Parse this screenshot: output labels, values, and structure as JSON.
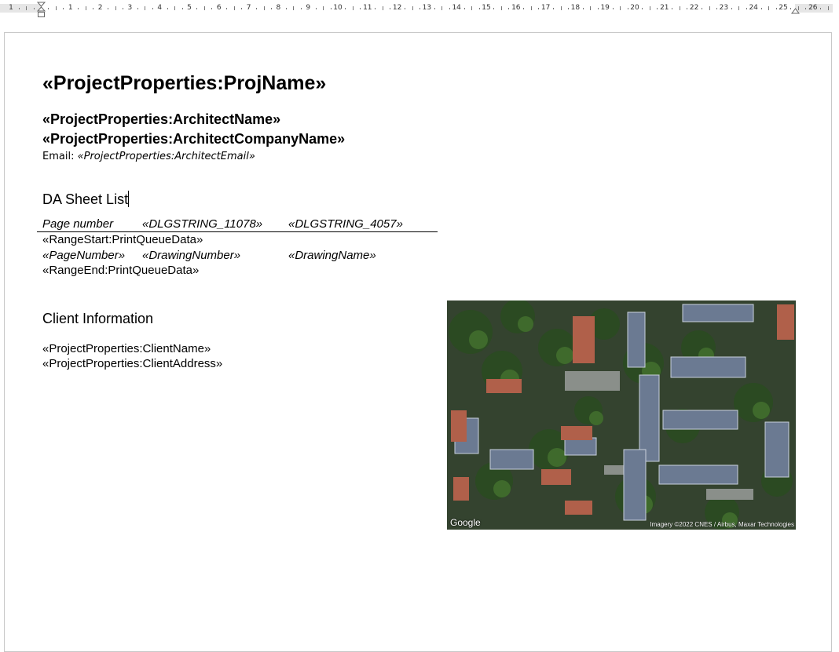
{
  "ruler": {
    "numbers": [
      "1",
      "1",
      "2",
      "3",
      "4",
      "5",
      "6",
      "7",
      "8",
      "9",
      "10",
      "11",
      "12",
      "13",
      "14",
      "15",
      "16",
      "17",
      "18",
      "19",
      "20",
      "21",
      "22",
      "23",
      "24",
      "25",
      "26"
    ]
  },
  "document": {
    "project_name_field": "«ProjectProperties:ProjName»",
    "architect_name_field": "«ProjectProperties:ArchitectName»",
    "architect_company_field": "«ProjectProperties:ArchitectCompanyName»",
    "email_label": "Email: ",
    "architect_email_field": "«ProjectProperties:ArchitectEmail»",
    "sheet_list_heading": "DA Sheet List",
    "table": {
      "headers": [
        "Page number",
        "«DLGSTRING_11078»",
        "«DLGSTRING_4057»"
      ],
      "range_start": "«RangeStart:PrintQueueData»",
      "row_fields": [
        "«PageNumber»",
        "«DrawingNumber»",
        "«DrawingName»"
      ],
      "range_end": "«RangeEnd:PrintQueueData»"
    },
    "client_heading": "Client Information",
    "client_name_field": "«ProjectProperties:ClientName»",
    "client_address_field": "«ProjectProperties:ClientAddress»"
  },
  "aerial_image": {
    "logo_text": "Google",
    "credit_text": "Imagery ©2022 CNES / Airbus, Maxar Technologies"
  },
  "colors": {
    "ruler_margin": "#e6e6e6",
    "page_border": "#c8c8c8"
  }
}
